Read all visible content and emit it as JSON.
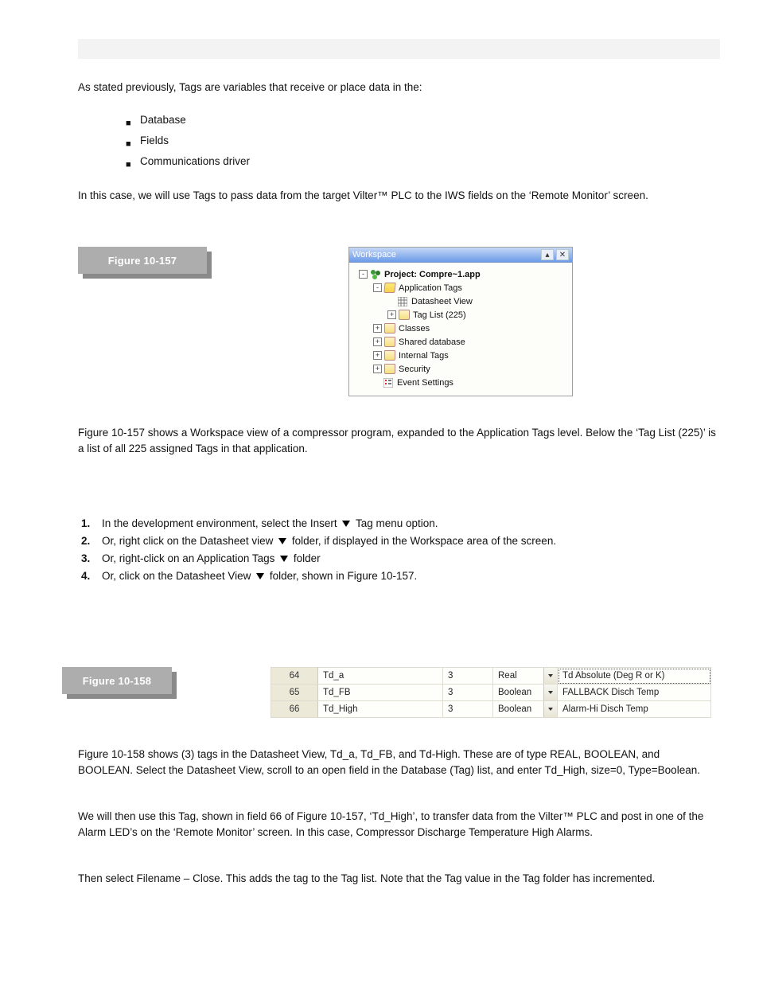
{
  "page": {
    "intro": "As stated previously, Tags are variables that receive or place data in the:",
    "bullet1": "Database",
    "bullet2": "Fields",
    "bullet3": "Communications driver",
    "para2": "In this case, we will use Tags to pass data from the target Vilter™ PLC to the IWS fields on the ‘Remote Monitor’ screen."
  },
  "fig1": {
    "label": "Figure 10-157"
  },
  "workspace": {
    "title": "Workspace",
    "project": "Project: Compre~1.app",
    "node_app_tags": "Application Tags",
    "node_datasheet": "Datasheet View",
    "node_taglist": "Tag List (225)",
    "node_classes": "Classes",
    "node_shared": "Shared database",
    "node_internal": "Internal Tags",
    "node_security": "Security",
    "node_event": "Event Settings"
  },
  "para3": "Figure 10-157 shows a Workspace view of a compressor program, expanded to the Application Tags level. Below the ‘Tag List (225)’ is a list of all 225 assigned Tags in that application.",
  "steps": {
    "s1": "In the development environment, select the Insert",
    "s1b": "Tag menu option.",
    "s2": "Or, right click on the Datasheet view",
    "s2b": "folder, if displayed in the Workspace area of the screen.",
    "s3": "Or, right-click on an Application Tags",
    "s3b": "folder",
    "s4": "Or, click on the Datasheet View",
    "s4b": "folder, shown in Figure 10-157."
  },
  "fig2": {
    "label": "Figure 10-158"
  },
  "table": {
    "r1": {
      "n": "64",
      "name": "Td_a",
      "c3": "3",
      "type": "Real",
      "desc": "Td Absolute (Deg R or K)"
    },
    "r2": {
      "n": "65",
      "name": "Td_FB",
      "c3": "3",
      "type": "Boolean",
      "desc": "FALLBACK Disch Temp"
    },
    "r3": {
      "n": "66",
      "name": "Td_High",
      "c3": "3",
      "type": "Boolean",
      "desc": "Alarm-Hi Disch Temp"
    }
  },
  "para4": "Figure 10-158 shows (3) tags in the Datasheet View, Td_a, Td_FB, and Td-High. These are of type REAL, BOOLEAN, and BOOLEAN. Select the Datasheet View, scroll to an open field in the Database (Tag) list, and enter Td_High, size=0, Type=Boolean.",
  "para5": "We will then use this Tag, shown in field 66 of Figure 10-157, ‘Td_High’, to transfer data from the Vilter™ PLC and post in one of the Alarm LED’s on the ‘Remote Monitor’ screen. In this case, Compressor Discharge Temperature High Alarms.",
  "para6": "Then select Filename – Close. This adds the tag to the Tag list. Note that the Tag value in the Tag folder has incremented."
}
